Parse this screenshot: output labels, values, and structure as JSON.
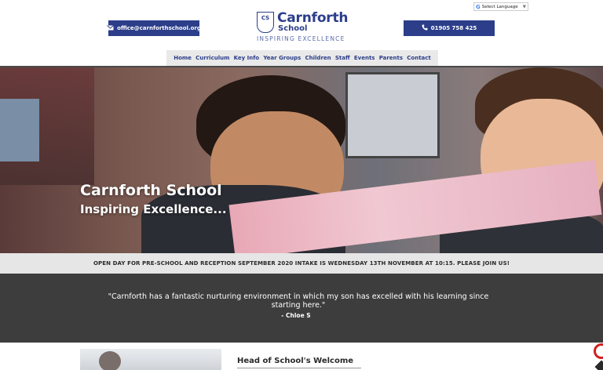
{
  "header": {
    "email_label": "office@carnforthschool.org",
    "phone_label": "01905 758 425",
    "logo": {
      "emblem_text": "CS",
      "name": "Carnforth",
      "sub": "School",
      "tagline": "INSPIRING EXCELLENCE"
    },
    "language_selector": {
      "label": "Select Language",
      "google_glyph": "G",
      "arrow": "▼"
    }
  },
  "nav": {
    "items": [
      {
        "label": "Home"
      },
      {
        "label": "Curriculum"
      },
      {
        "label": "Key Info"
      },
      {
        "label": "Year Groups"
      },
      {
        "label": "Children"
      },
      {
        "label": "Staff"
      },
      {
        "label": "Events"
      },
      {
        "label": "Parents"
      },
      {
        "label": "Contact"
      }
    ]
  },
  "hero": {
    "title": "Carnforth School",
    "subtitle": "Inspiring Excellence..."
  },
  "announcement": {
    "text": "OPEN DAY FOR PRE-SCHOOL AND RECEPTION SEPTEMBER 2020 INTAKE IS WEDNESDAY 13TH NOVEMBER AT 10:15. PLEASE JOIN US!"
  },
  "testimonial": {
    "quote": "\"Carnforth has a fantastic nurturing environment in which my son has excelled with his learning since starting here.\"",
    "author": "- Chloe S"
  },
  "welcome": {
    "heading": "Head of School's Welcome"
  },
  "colors": {
    "brand_blue": "#2c3e8a",
    "nav_bg": "#e9e9e9",
    "testimonial_bg": "#3d3d3d",
    "announce_bg": "#e6e6e6"
  },
  "icons": {
    "email": "envelope-icon",
    "phone": "phone-icon",
    "google": "google-icon"
  }
}
